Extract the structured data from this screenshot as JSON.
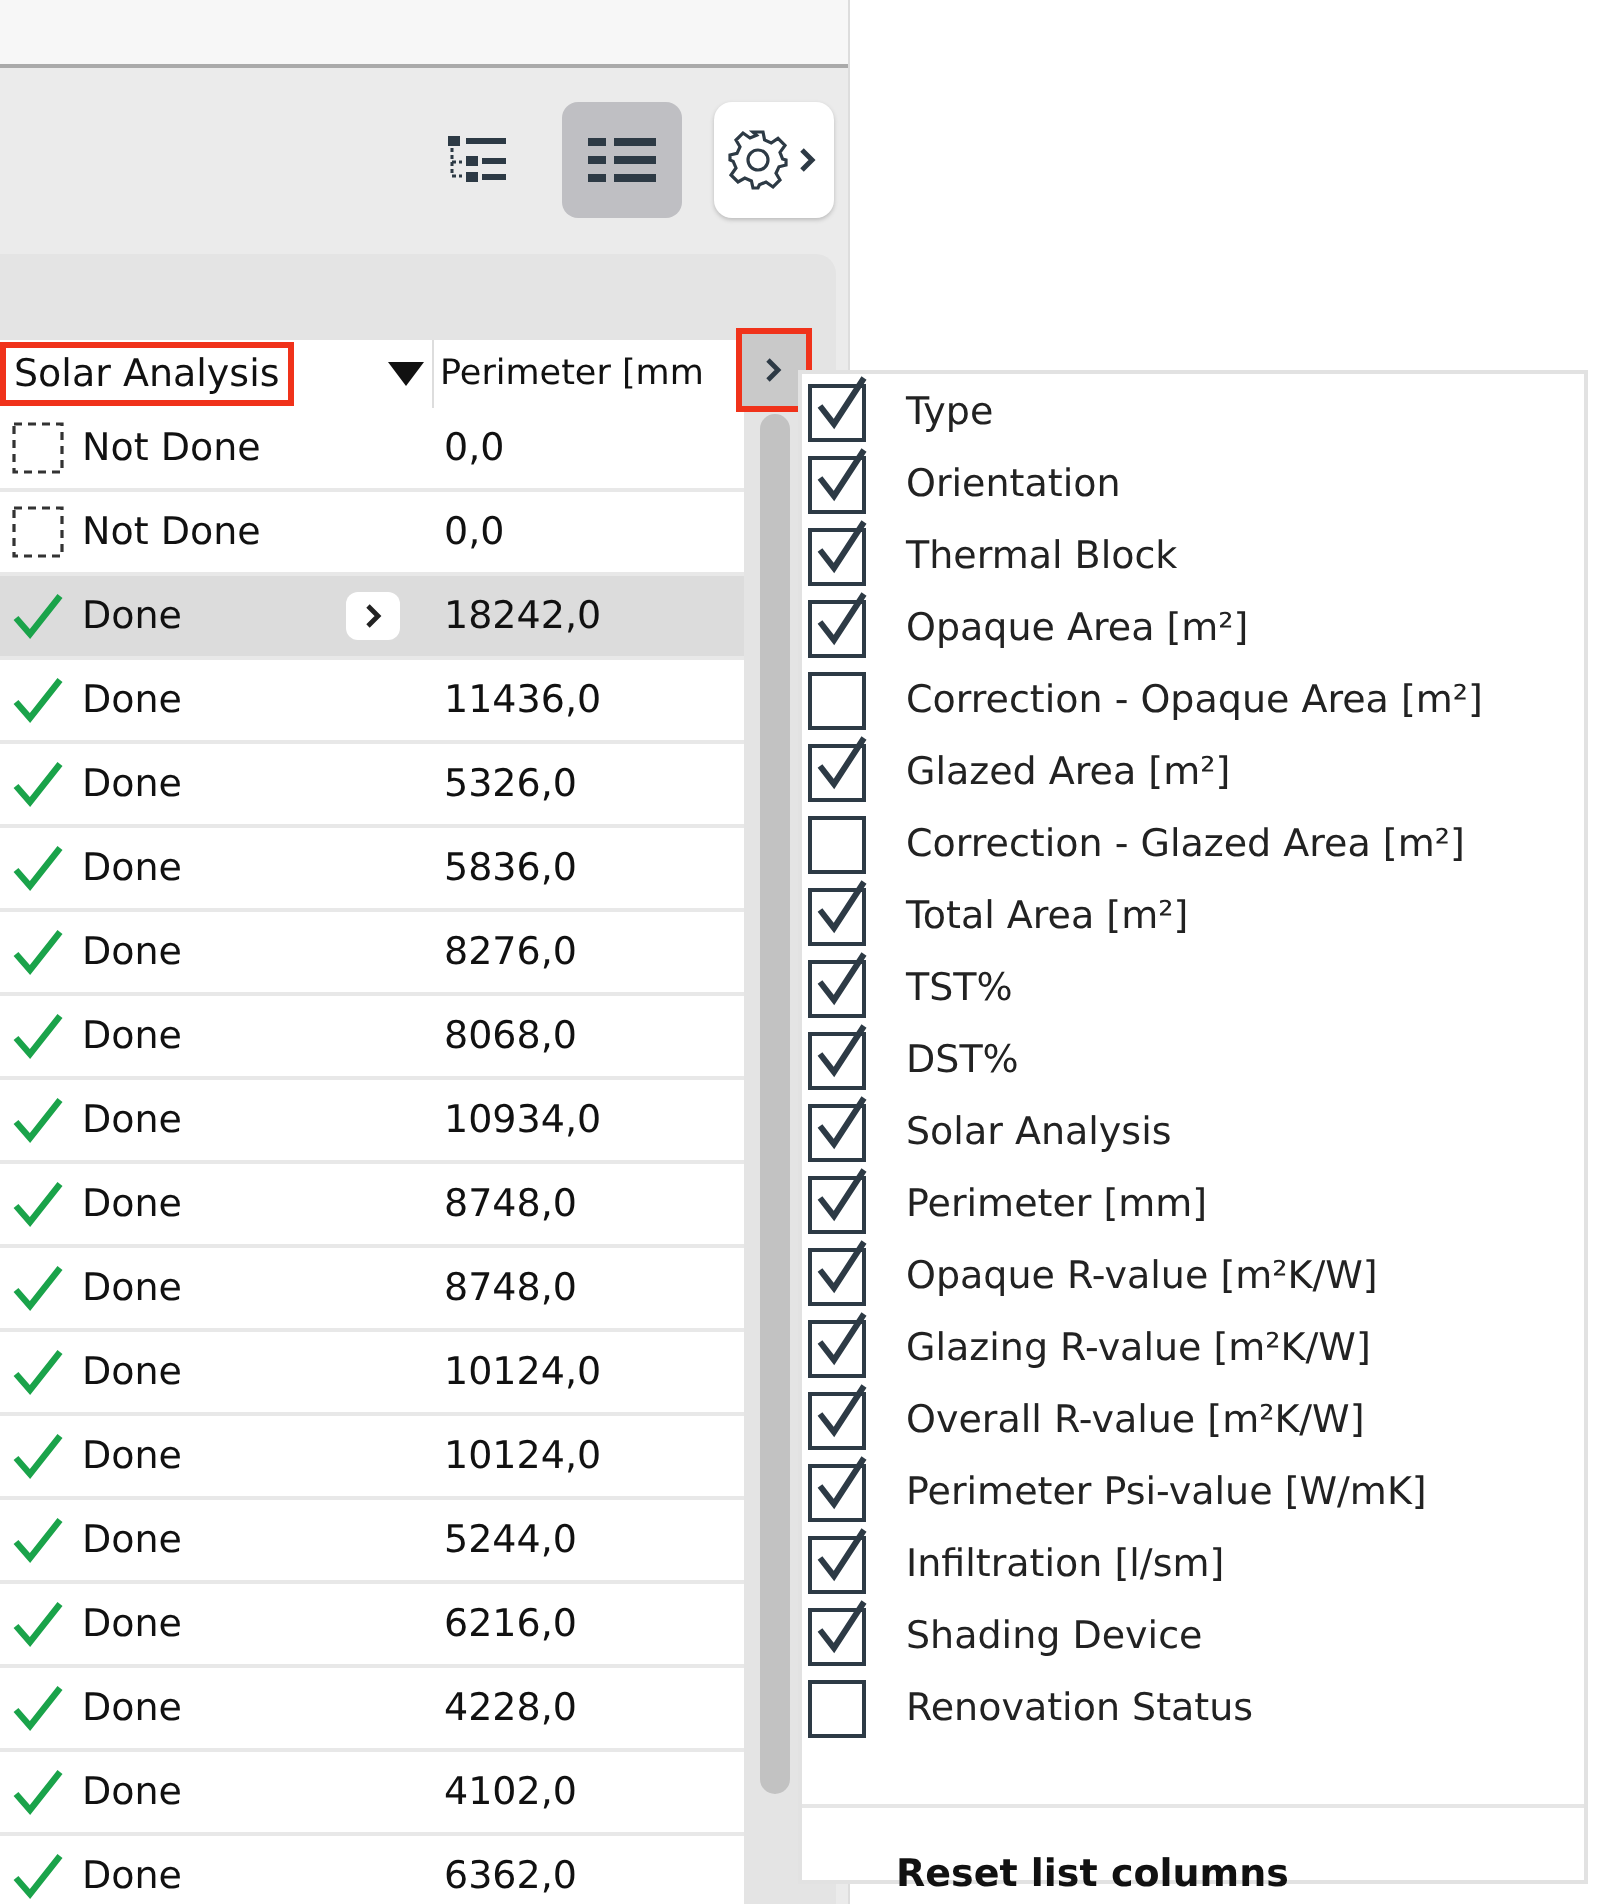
{
  "toolbar": {
    "view_buttons": [
      {
        "kind": "tree",
        "selected": false
      },
      {
        "kind": "list",
        "selected": true
      }
    ],
    "settings_button": {
      "kind": "gear"
    }
  },
  "table": {
    "columns": [
      {
        "label": "Solar Analysis",
        "highlighted": true,
        "sort_descending": true
      },
      {
        "label": "Perimeter [mm",
        "highlighted": false
      }
    ],
    "column_menu_button": {
      "highlighted": true
    },
    "rows": [
      {
        "status": "Not Done",
        "done": false,
        "perimeter": "0,0",
        "selected": false
      },
      {
        "status": "Not Done",
        "done": false,
        "perimeter": "0,0",
        "selected": false
      },
      {
        "status": "Done",
        "done": true,
        "perimeter": "18242,0",
        "selected": true
      },
      {
        "status": "Done",
        "done": true,
        "perimeter": "11436,0",
        "selected": false
      },
      {
        "status": "Done",
        "done": true,
        "perimeter": "5326,0",
        "selected": false
      },
      {
        "status": "Done",
        "done": true,
        "perimeter": "5836,0",
        "selected": false
      },
      {
        "status": "Done",
        "done": true,
        "perimeter": "8276,0",
        "selected": false
      },
      {
        "status": "Done",
        "done": true,
        "perimeter": "8068,0",
        "selected": false
      },
      {
        "status": "Done",
        "done": true,
        "perimeter": "10934,0",
        "selected": false
      },
      {
        "status": "Done",
        "done": true,
        "perimeter": "8748,0",
        "selected": false
      },
      {
        "status": "Done",
        "done": true,
        "perimeter": "8748,0",
        "selected": false
      },
      {
        "status": "Done",
        "done": true,
        "perimeter": "10124,0",
        "selected": false
      },
      {
        "status": "Done",
        "done": true,
        "perimeter": "10124,0",
        "selected": false
      },
      {
        "status": "Done",
        "done": true,
        "perimeter": "5244,0",
        "selected": false
      },
      {
        "status": "Done",
        "done": true,
        "perimeter": "6216,0",
        "selected": false
      },
      {
        "status": "Done",
        "done": true,
        "perimeter": "4228,0",
        "selected": false
      },
      {
        "status": "Done",
        "done": true,
        "perimeter": "4102,0",
        "selected": false
      },
      {
        "status": "Done",
        "done": true,
        "perimeter": "6362,0",
        "selected": false
      }
    ]
  },
  "column_menu": {
    "items": [
      {
        "label": "Type",
        "checked": true
      },
      {
        "label": "Orientation",
        "checked": true
      },
      {
        "label": "Thermal Block",
        "checked": true
      },
      {
        "label": "Opaque Area [m²]",
        "checked": true
      },
      {
        "label": "Correction - Opaque Area [m²]",
        "checked": false
      },
      {
        "label": "Glazed Area [m²]",
        "checked": true
      },
      {
        "label": "Correction - Glazed Area [m²]",
        "checked": false
      },
      {
        "label": "Total Area [m²]",
        "checked": true
      },
      {
        "label": "TST%",
        "checked": true
      },
      {
        "label": "DST%",
        "checked": true
      },
      {
        "label": "Solar Analysis",
        "checked": true
      },
      {
        "label": "Perimeter [mm]",
        "checked": true
      },
      {
        "label": "Opaque R-value [m²K/W]",
        "checked": true
      },
      {
        "label": "Glazing R-value [m²K/W]",
        "checked": true
      },
      {
        "label": "Overall R-value [m²K/W]",
        "checked": true
      },
      {
        "label": "Perimeter Psi-value [W/mK]",
        "checked": true
      },
      {
        "label": "Infiltration [l/sm]",
        "checked": true
      },
      {
        "label": "Shading Device",
        "checked": true
      },
      {
        "label": "Renovation Status",
        "checked": false
      }
    ],
    "reset_label": "Reset list columns"
  }
}
